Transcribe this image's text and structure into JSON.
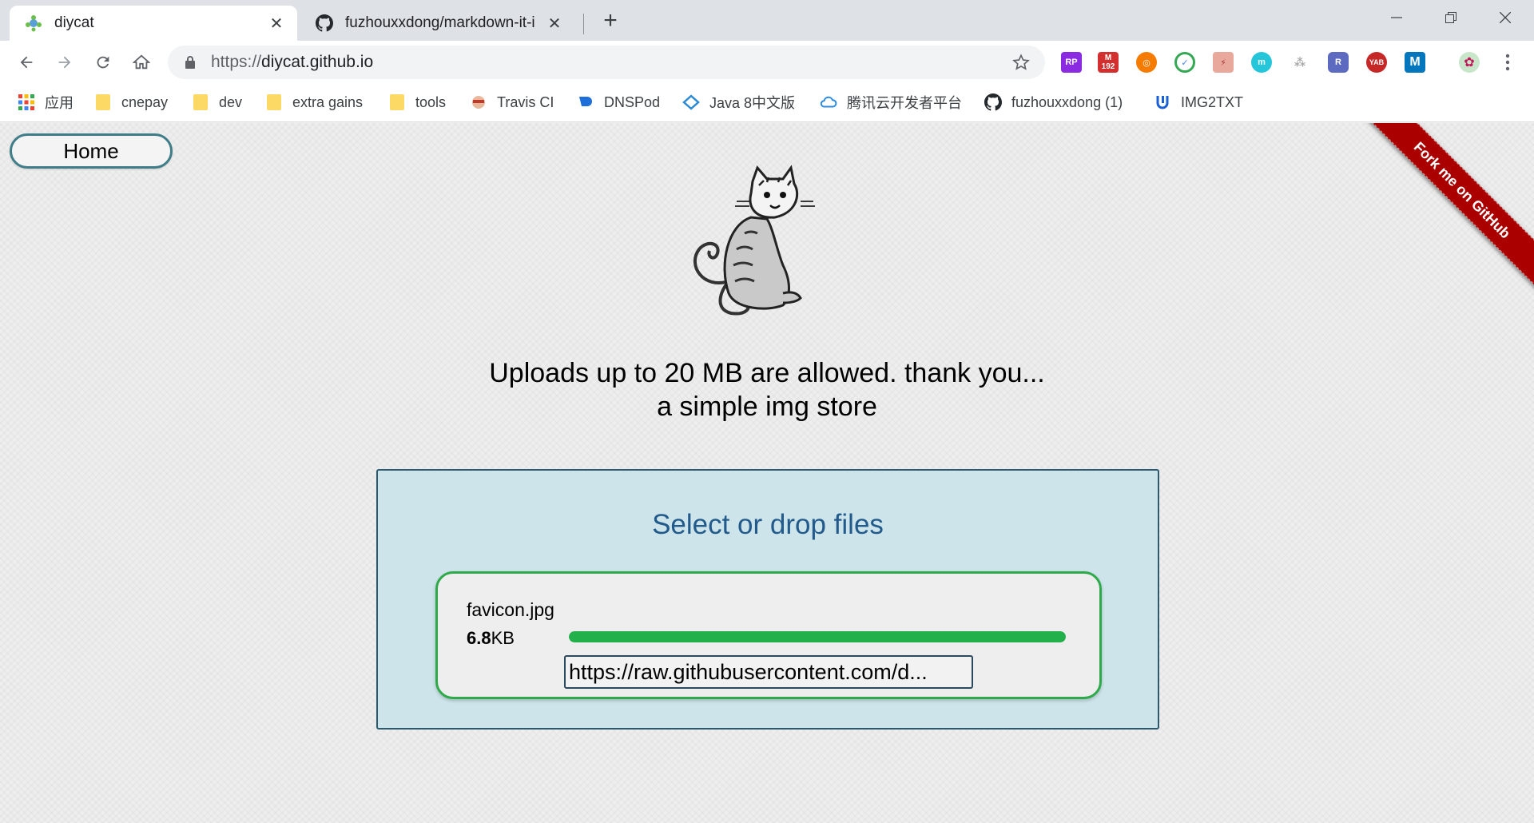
{
  "tabs": [
    {
      "title": "diycat",
      "active": true
    },
    {
      "title": "fuzhouxxdong/markdown-it-i",
      "active": false
    }
  ],
  "address_bar": {
    "scheme": "https://",
    "host": "diycat.github.io"
  },
  "bookmarks": [
    {
      "label": "应用",
      "icon": "apps-grid-icon"
    },
    {
      "label": "cnepay",
      "icon": "folder-icon"
    },
    {
      "label": "dev",
      "icon": "folder-icon"
    },
    {
      "label": "extra gains",
      "icon": "folder-icon"
    },
    {
      "label": "tools",
      "icon": "folder-icon"
    },
    {
      "label": "Travis CI",
      "icon": "travis-icon"
    },
    {
      "label": "DNSPod",
      "icon": "dnspod-icon"
    },
    {
      "label": "Java 8中文版",
      "icon": "java-icon"
    },
    {
      "label": "腾讯云开发者平台",
      "icon": "cloud-icon"
    },
    {
      "label": "fuzhouxxdong (1)",
      "icon": "github-icon"
    },
    {
      "label": "IMG2TXT",
      "icon": "img2txt-icon"
    }
  ],
  "extensions": {
    "gmail_badge": "192",
    "rp": "RP",
    "r": "R",
    "yab": "YAB",
    "m": "M"
  },
  "page": {
    "home_label": "Home",
    "ribbon_text": "Fork me on GitHub",
    "tagline_line1": "Uploads up to 20 MB are allowed. thank you...",
    "tagline_line2": "a simple img store",
    "dropzone_title": "Select or drop files",
    "file": {
      "name": "favicon.jpg",
      "size_value": "6.8",
      "size_unit": "KB",
      "progress_percent": 100,
      "url": "https://raw.githubusercontent.com/d..."
    }
  },
  "colors": {
    "progress": "#22b04b",
    "dropzone_bg": "#cce4ea",
    "ribbon": "#aa0000",
    "dropzone_title": "#225a8c"
  }
}
